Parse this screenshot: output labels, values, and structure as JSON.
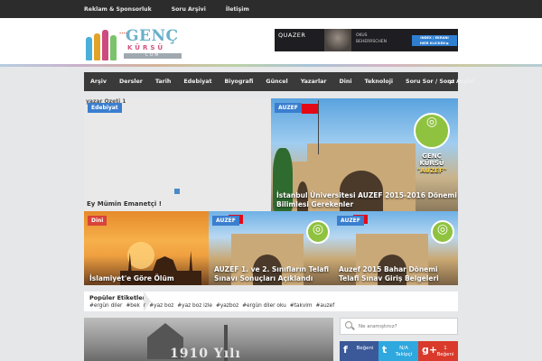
{
  "topbar": {
    "links": [
      "Reklam & Sponsorluk",
      "Soru Arşivi",
      "İletişim"
    ]
  },
  "logo": {
    "name": "GENÇ",
    "subtitle": "KÜRSÜ",
    "domain": "COM",
    "tagline": "••••"
  },
  "banner": {
    "brand": "QUAZER",
    "line1": "OKUS",
    "line2": "BEHERRSCHEN",
    "cta": "INDEX / EKRANI\nHIER KLICKEN ▶"
  },
  "nav": {
    "items": [
      "Arşiv",
      "Dersler",
      "Tarih",
      "Edebiyat",
      "Biyografi",
      "Güncel",
      "Yazarlar",
      "Dini",
      "Teknoloji",
      "Soru Sor / Soru Arşivi"
    ],
    "shuffle_icon": "shuffle-icon"
  },
  "featured": [
    {
      "category": "Edebiyat",
      "overline": "yazar Özeti 1",
      "title": "Ey Mümin Emanetçi !",
      "badge_color": "#3a7ecf"
    },
    {
      "category": "AUZEF",
      "title": "İstanbul Üniversitesi AUZEF 2015-2016 Dönemi Bilimlesi Gerekenler",
      "badge_color": "#3a7ecf"
    },
    {
      "category": "Dini",
      "title": "İslamiyet'e Göre Ölüm",
      "badge_color": "#d8433a"
    },
    {
      "category": "AUZEF",
      "title": "AUZEF 1. ve 2. Sınıfların Telafi Sınavı Sonuçları Açıklandı",
      "badge_color": "#3a7ecf"
    },
    {
      "category": "AUZEF",
      "title": "Auzef 2015 Bahar Dönemi Telafi Sınav Giriş Belgeleri",
      "badge_color": "#3a7ecf"
    }
  ],
  "genc_kursu_label": {
    "line1": "GENÇ",
    "line2": "KÜRSÜ",
    "line3": "\"AUZEF\""
  },
  "popular_tags": {
    "title": "Popüler Etiketler",
    "tags": [
      "#ergün diler",
      "#bek",
      "r",
      "#yaz boz",
      "#yaz boz izle",
      "#yazboz",
      "#ergün diler oku",
      "#takvim",
      "#auzef"
    ]
  },
  "photo": {
    "caption": "1910 Yılı"
  },
  "search": {
    "placeholder": "Ne aramıştınız?"
  },
  "social": [
    {
      "icon": "f",
      "count": "",
      "label": "Beğeni"
    },
    {
      "icon": "t",
      "count": "N/A",
      "label": "Takipçi"
    },
    {
      "icon": "g+",
      "count": "1",
      "label": "Beğeni"
    }
  ],
  "colors": {
    "topbar": "#2c2c2c",
    "nav": "#3a3a3a",
    "facebook": "#3b5998",
    "twitter": "#2fa8df",
    "googleplus": "#d93a2b"
  }
}
